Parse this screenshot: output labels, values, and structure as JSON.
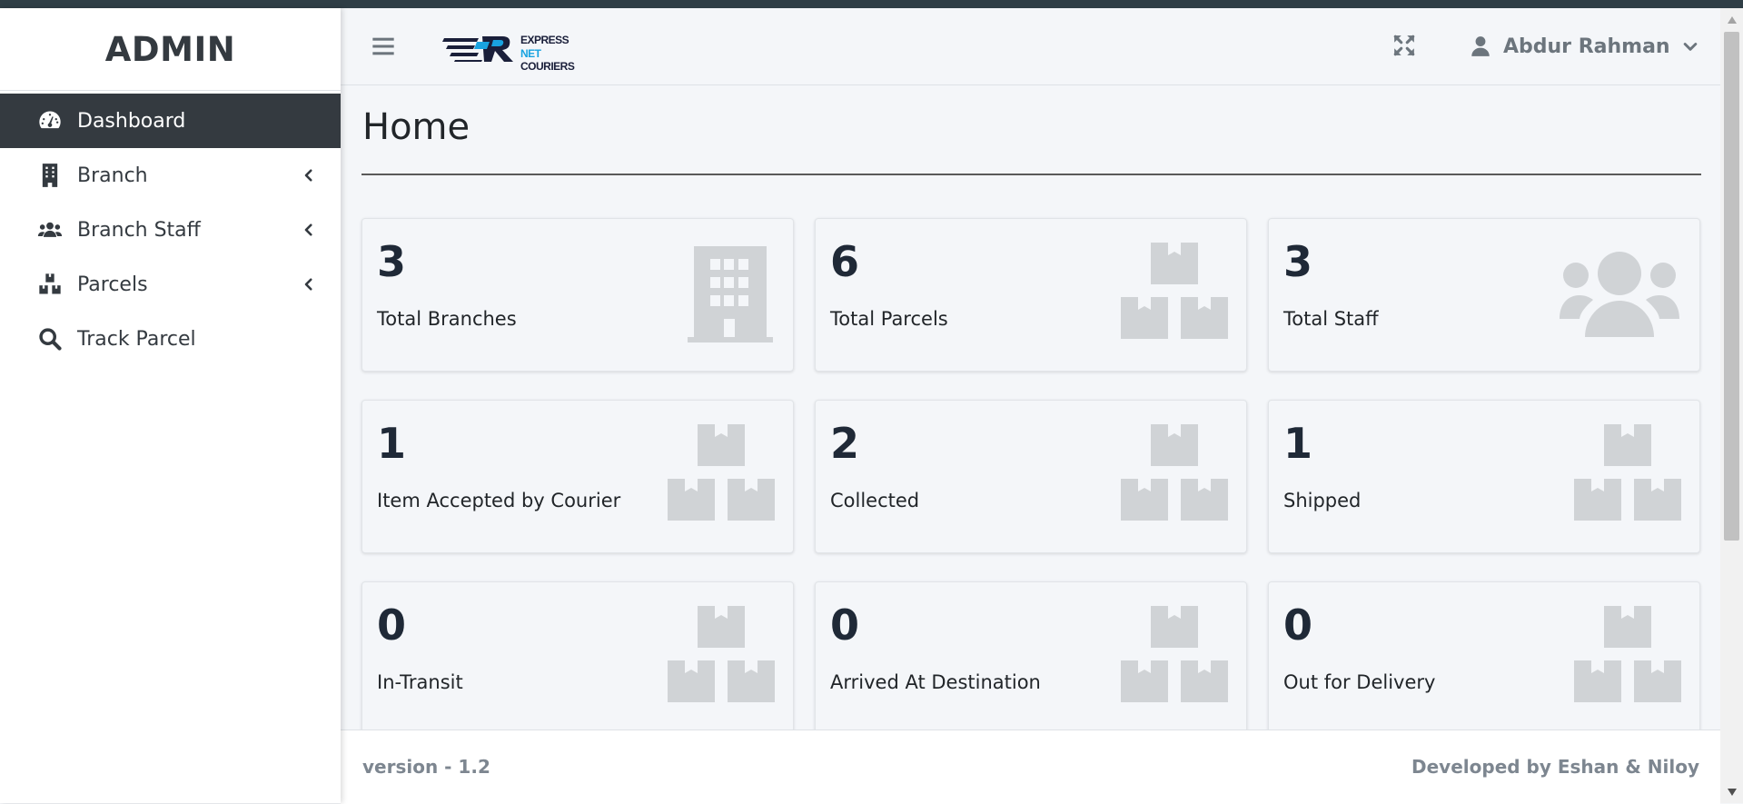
{
  "sidebar": {
    "brand": "ADMIN",
    "items": [
      {
        "label": "Dashboard",
        "icon": "tachometer-icon",
        "active": true
      },
      {
        "label": "Branch",
        "icon": "building-icon",
        "has_submenu": true
      },
      {
        "label": "Branch Staff",
        "icon": "users-icon",
        "has_submenu": true
      },
      {
        "label": "Parcels",
        "icon": "boxes-icon",
        "has_submenu": true
      },
      {
        "label": "Track Parcel",
        "icon": "search-icon"
      }
    ]
  },
  "header": {
    "menu_icon": "hamburger-icon",
    "logo": {
      "line1": "EXPRESS",
      "line2_accent": "NET",
      "line2_rest": " COURIERS"
    },
    "fullscreen_icon": "expand-icon",
    "user": {
      "name": "Abdur Rahman",
      "icon": "user-icon"
    }
  },
  "main": {
    "title": "Home",
    "cards": [
      {
        "value": "3",
        "label": "Total Branches",
        "icon": "building-icon"
      },
      {
        "value": "6",
        "label": "Total Parcels",
        "icon": "boxes-icon"
      },
      {
        "value": "3",
        "label": "Total Staff",
        "icon": "users-icon"
      },
      {
        "value": "1",
        "label": "Item Accepted by Courier",
        "icon": "boxes-icon"
      },
      {
        "value": "2",
        "label": "Collected",
        "icon": "boxes-icon"
      },
      {
        "value": "1",
        "label": "Shipped",
        "icon": "boxes-icon"
      },
      {
        "value": "0",
        "label": "In-Transit",
        "icon": "boxes-icon"
      },
      {
        "value": "0",
        "label": "Arrived At Destination",
        "icon": "boxes-icon"
      },
      {
        "value": "0",
        "label": "Out for Delivery",
        "icon": "boxes-icon"
      }
    ]
  },
  "footer": {
    "version": "version - 1.2",
    "credits": "Developed by Eshan & Niloy"
  },
  "colors": {
    "sidebar_active_bg": "#343a40",
    "page_bg": "#f4f6f9",
    "card_icon": "#d0d3d6",
    "logo_accent": "#19a3e0",
    "logo_dark": "#1a1f3a"
  }
}
